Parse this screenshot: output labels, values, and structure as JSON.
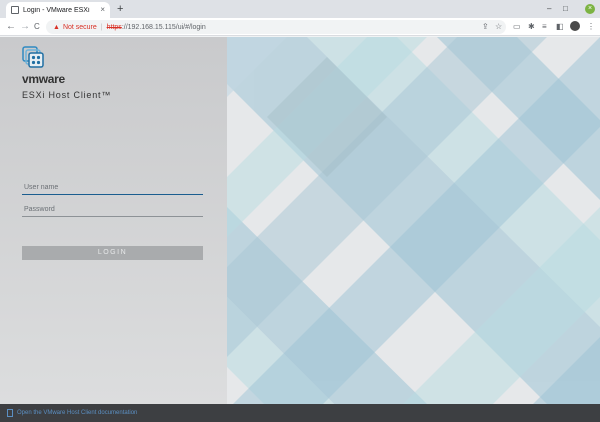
{
  "browser": {
    "tab_title": "Login - VMware ESXi",
    "tab_close": "×",
    "new_tab": "+",
    "window_controls": {
      "minimize": "–",
      "maximize": "□",
      "close": "×"
    },
    "nav": {
      "back": "←",
      "forward": "→",
      "reload": "C"
    },
    "security_warning": "Not secure",
    "url_protocol": "https",
    "url_rest": "://192.168.15.115/ui/#/login",
    "toolbar_icons": [
      "share-icon",
      "star-icon",
      "extensions-icon",
      "puzzle-icon",
      "media-icon",
      "sidepanel-icon",
      "profile-icon",
      "menu-icon"
    ]
  },
  "login": {
    "brand": "vmware",
    "product": "ESXi Host Client™",
    "username_placeholder": "User name",
    "password_placeholder": "Password",
    "login_button": "LOGIN"
  },
  "footer": {
    "doc_link": "Open the VMware Host Client documentation"
  },
  "colors": {
    "left_panel": "#cfd0d2",
    "field_underline_active": "#1a5d8f",
    "login_button": "#a9abad",
    "footer_bg": "#3d3f42",
    "footer_link": "#5b8fc2",
    "pattern_blue": "#9ec4d6",
    "pattern_teal": "#b9dde2"
  }
}
